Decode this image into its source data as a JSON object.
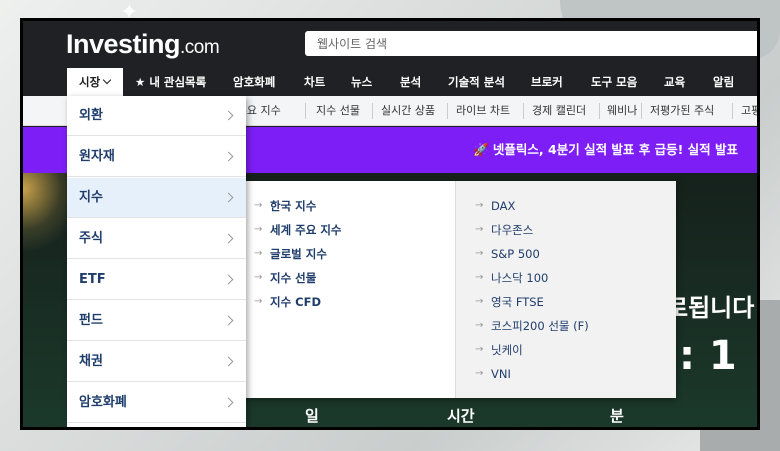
{
  "header": {
    "logo_main": "Investing",
    "logo_suffix": ".com",
    "search_placeholder": "웹사이트 검색"
  },
  "nav": {
    "items": [
      "시장",
      "★ 내 관심목록",
      "암호화폐",
      "차트",
      "뉴스",
      "분석",
      "기술적 분석",
      "브로커",
      "도구 모음",
      "교육",
      "알림"
    ]
  },
  "subnav": {
    "items": [
      "세계 주요 지수",
      "지수 선물",
      "실시간 상품",
      "라이브 차트",
      "경제 캘린더",
      "웨비나",
      "저평가된 주식",
      "고평"
    ]
  },
  "banner": {
    "text": "🚀 넷플릭스, 4분기 실적 발표 후 급등! 실적 발표"
  },
  "hero": {
    "title": "로됩니다",
    "countdown": ":  1",
    "labels": [
      "일",
      "시간",
      "분"
    ]
  },
  "menu": {
    "items": [
      "외환",
      "원자재",
      "지수",
      "주식",
      "ETF",
      "펀드",
      "채권",
      "암호화폐"
    ],
    "active": "지수"
  },
  "flyout": {
    "col1": [
      "한국 지수",
      "세계 주요 지수",
      "글로벌 지수",
      "지수 선물",
      "지수 CFD"
    ],
    "col2": [
      "DAX",
      "다우존스",
      "S&P 500",
      "나스닥 100",
      "영국 FTSE",
      "코스피200 선물 (F)",
      "닛케이",
      "VNI"
    ]
  },
  "colors": {
    "banner": "#7e1ef7",
    "topbar": "#202124",
    "link": "#1f3d6b",
    "active_bg": "#e6f0fb"
  }
}
